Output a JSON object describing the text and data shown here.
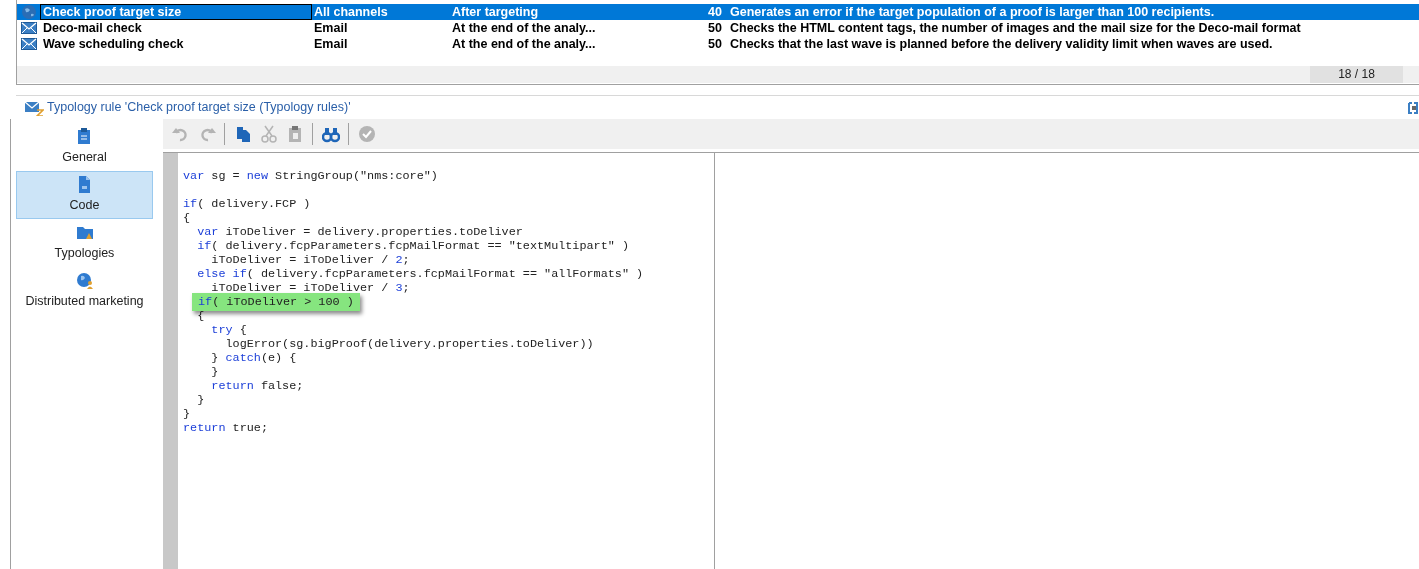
{
  "list": {
    "rows": [
      {
        "kind": "globe",
        "name": "Check proof target size",
        "channel": "All channels",
        "when": "After targeting",
        "priority": "40",
        "description": "Generates an error if the target population of a proof is larger than 100 recipients.",
        "selected": true
      },
      {
        "kind": "email",
        "name": "Deco-mail check",
        "channel": "Email",
        "when": "At the end of the analy...",
        "priority": "50",
        "description": "Checks the HTML content tags, the number of images and the mail size for the Deco-mail format",
        "selected": false
      },
      {
        "kind": "email",
        "name": "Wave scheduling check",
        "channel": "Email",
        "when": "At the end of the analy...",
        "priority": "50",
        "description": "Checks that the last wave is planned before the delivery validity limit when waves are used.",
        "selected": false
      }
    ],
    "count": "18 / 18"
  },
  "detail": {
    "title": "Typology rule 'Check proof target size (Typology rules)'"
  },
  "sidebar": {
    "items": [
      {
        "kind": "clipboard",
        "label": "General",
        "selected": false
      },
      {
        "kind": "script",
        "label": "Code",
        "selected": true
      },
      {
        "kind": "folder",
        "label": "Typologies",
        "selected": false
      },
      {
        "kind": "globe",
        "label": "Distributed marketing",
        "selected": false
      }
    ]
  },
  "toolbar": [
    {
      "kind": "undo",
      "disabled": true
    },
    {
      "kind": "redo",
      "disabled": true
    },
    {
      "kind": "separator"
    },
    {
      "kind": "copy",
      "disabled": false
    },
    {
      "kind": "cut",
      "disabled": true
    },
    {
      "kind": "paste",
      "disabled": true
    },
    {
      "kind": "separator"
    },
    {
      "kind": "find",
      "disabled": false
    },
    {
      "kind": "separator"
    },
    {
      "kind": "check",
      "disabled": true
    }
  ],
  "code": {
    "lines": [
      {
        "kind": "code",
        "segments": [
          {
            "text": "var",
            "kind": "keyword"
          },
          {
            "text": " sg = ",
            "kind": "plain"
          },
          {
            "text": "new",
            "kind": "keyword"
          },
          {
            "text": " StringGroup(\"nms:core\")",
            "kind": "plain"
          }
        ]
      },
      {
        "kind": "blank"
      },
      {
        "kind": "code",
        "segments": [
          {
            "text": "if",
            "kind": "keyword"
          },
          {
            "text": "( delivery.FCP )",
            "kind": "plain"
          }
        ]
      },
      {
        "kind": "code",
        "segments": [
          {
            "text": "{",
            "kind": "plain"
          }
        ]
      },
      {
        "kind": "code",
        "segments": [
          {
            "text": "  var",
            "kind": "keyword"
          },
          {
            "text": " iToDeliver = delivery.properties.toDeliver",
            "kind": "plain"
          }
        ]
      },
      {
        "kind": "code",
        "segments": [
          {
            "text": "  if",
            "kind": "keyword"
          },
          {
            "text": "( delivery.fcpParameters.fcpMailFormat == \"textMultipart\" )",
            "kind": "plain"
          }
        ]
      },
      {
        "kind": "code",
        "segments": [
          {
            "text": "    iToDeliver = iToDeliver / ",
            "kind": "plain"
          },
          {
            "text": "2",
            "kind": "keyword"
          },
          {
            "text": ";",
            "kind": "plain"
          }
        ]
      },
      {
        "kind": "code",
        "segments": [
          {
            "text": "  else if",
            "kind": "keyword"
          },
          {
            "text": "( delivery.fcpParameters.fcpMailFormat == \"allFormats\" )",
            "kind": "plain"
          }
        ]
      },
      {
        "kind": "code",
        "segments": [
          {
            "text": "    iToDeliver = iToDeliver / ",
            "kind": "plain"
          },
          {
            "text": "3",
            "kind": "keyword"
          },
          {
            "text": ";",
            "kind": "plain"
          }
        ]
      },
      {
        "kind": "code",
        "highlighted": true,
        "segments": [
          {
            "text": "if",
            "kind": "keyword"
          },
          {
            "text": "( iToDeliver > 100 )",
            "kind": "plain"
          }
        ]
      },
      {
        "kind": "code",
        "segments": [
          {
            "text": "  {",
            "kind": "plain"
          }
        ]
      },
      {
        "kind": "code",
        "segments": [
          {
            "text": "    try",
            "kind": "keyword"
          },
          {
            "text": " {",
            "kind": "plain"
          }
        ]
      },
      {
        "kind": "code",
        "segments": [
          {
            "text": "      logError(sg.bigProof(delivery.properties.toDeliver))",
            "kind": "plain"
          }
        ]
      },
      {
        "kind": "code",
        "segments": [
          {
            "text": "    } ",
            "kind": "plain"
          },
          {
            "text": "catch",
            "kind": "keyword"
          },
          {
            "text": "(e) {",
            "kind": "plain"
          }
        ]
      },
      {
        "kind": "code",
        "segments": [
          {
            "text": "    }",
            "kind": "plain"
          }
        ]
      },
      {
        "kind": "code",
        "segments": [
          {
            "text": "    return",
            "kind": "keyword"
          },
          {
            "text": " false;",
            "kind": "plain"
          }
        ]
      },
      {
        "kind": "code",
        "segments": [
          {
            "text": "  }",
            "kind": "plain"
          }
        ]
      },
      {
        "kind": "code",
        "segments": [
          {
            "text": "}",
            "kind": "plain"
          }
        ]
      },
      {
        "kind": "code",
        "segments": [
          {
            "text": "return",
            "kind": "keyword"
          },
          {
            "text": " true;",
            "kind": "plain"
          }
        ]
      }
    ]
  }
}
